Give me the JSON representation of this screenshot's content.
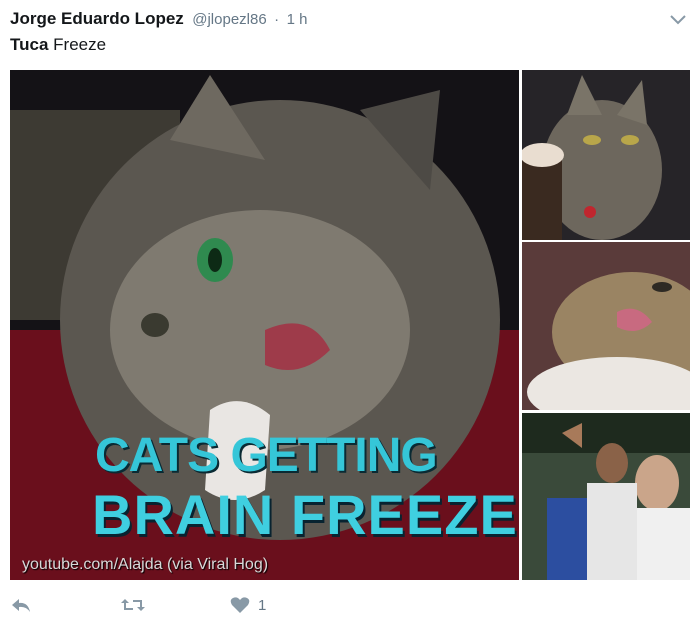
{
  "tweet": {
    "author_name": "Jorge Eduardo Lopez",
    "author_handle": "@jlopezl86",
    "separator": "·",
    "time": "1 h",
    "text_bold": "Tuca",
    "text_rest": " Freeze"
  },
  "media": {
    "overlay_title": "CATS GETTING",
    "overlay_subtitle": "BRAIN FREEZE",
    "caption": "youtube.com/Alajda (via Viral Hog)"
  },
  "actions": {
    "like_count": "1"
  },
  "colors": {
    "overlay_text": "#35c6d8",
    "meta_text": "#657786"
  }
}
